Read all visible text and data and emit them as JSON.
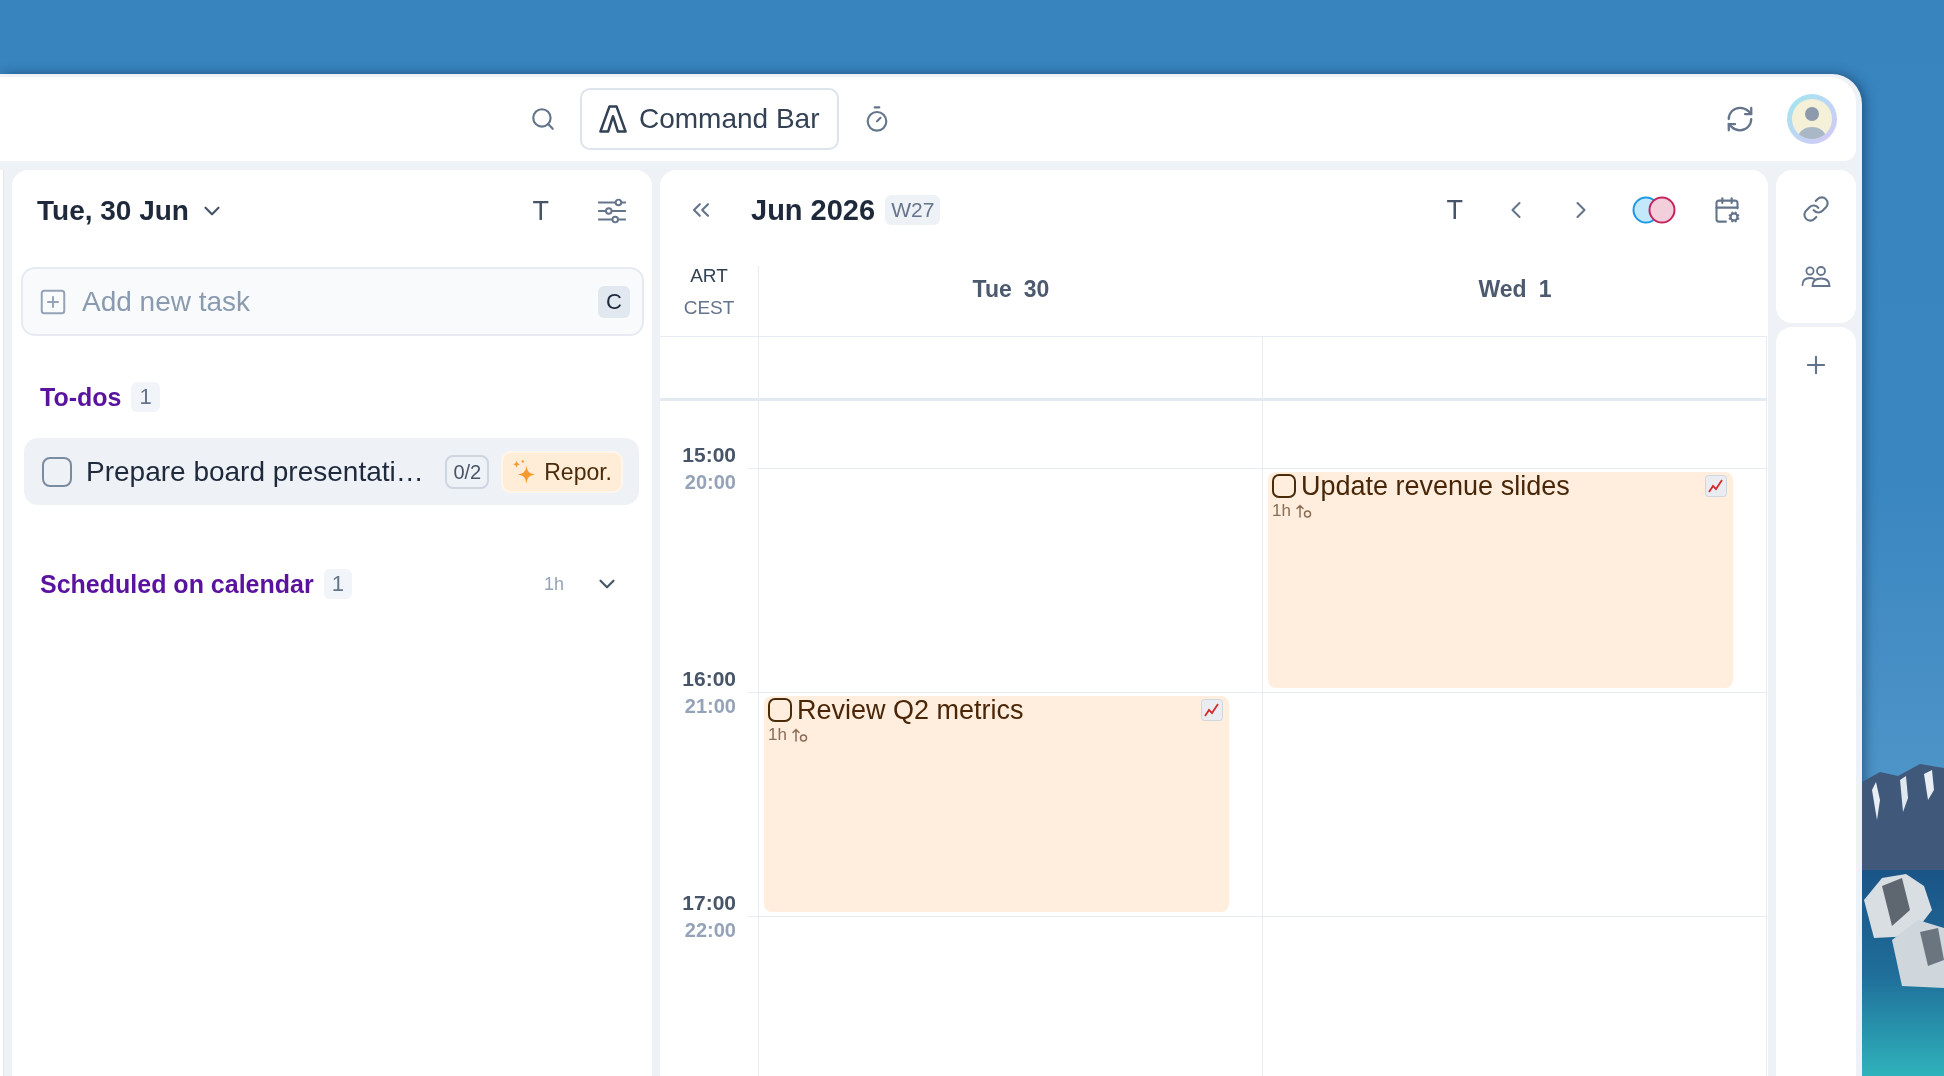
{
  "topbar": {
    "command_bar": "Command Bar"
  },
  "task_panel": {
    "date": "Tue, 30 Jun",
    "today_button": "T",
    "new_task": {
      "placeholder": "Add new task",
      "shortcut": "C"
    },
    "sections": [
      {
        "kind": "list",
        "title": "To-dos",
        "count": "1",
        "tasks": [
          {
            "title": "Prepare board presentati…",
            "checked": false,
            "subtasks": "0/2",
            "tag": "Repor."
          }
        ]
      },
      {
        "kind": "collapsible",
        "title": "Scheduled on calendar",
        "count": "1",
        "duration": "1h",
        "expanded": false
      }
    ]
  },
  "calendar": {
    "month": "Jun 2026",
    "week": "W27",
    "today_button": "T",
    "timezones": [
      "ART",
      "CEST"
    ],
    "hours": [
      {
        "primary": "15:00",
        "secondary": "20:00"
      },
      {
        "primary": "16:00",
        "secondary": "21:00"
      },
      {
        "primary": "17:00",
        "secondary": "22:00"
      }
    ],
    "days": [
      {
        "weekday": "Tue",
        "day": "30",
        "slots": [
          {
            "kind": "free"
          },
          {
            "kind": "event",
            "title": "Review Q2 metrics",
            "duration": "1h",
            "checked": false
          },
          {
            "kind": "free"
          }
        ]
      },
      {
        "weekday": "Wed",
        "day": "1",
        "slots": [
          {
            "kind": "event",
            "title": "Update revenue slides",
            "duration": "1h",
            "checked": false
          },
          {
            "kind": "free"
          },
          {
            "kind": "free"
          }
        ]
      }
    ]
  }
}
